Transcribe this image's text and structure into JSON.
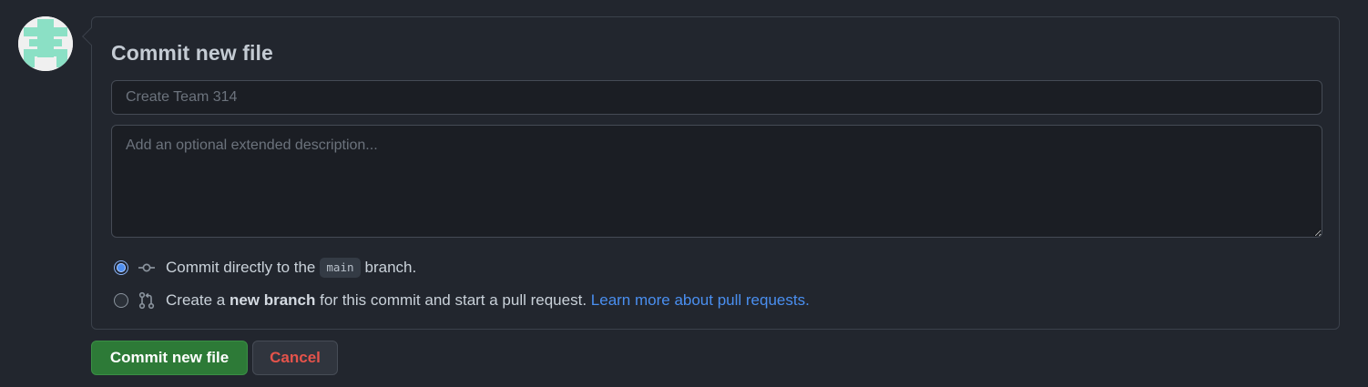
{
  "form": {
    "title": "Commit new file",
    "summary_placeholder": "Create Team 314",
    "summary_value": "",
    "description_placeholder": "Add an optional extended description...",
    "description_value": ""
  },
  "options": {
    "direct": {
      "selected": true,
      "prefix": "Commit directly to the",
      "branch": "main",
      "suffix": "branch."
    },
    "new_branch": {
      "selected": false,
      "prefix": "Create a",
      "bold": "new branch",
      "suffix": "for this commit and start a pull request.",
      "link": "Learn more about pull requests."
    }
  },
  "buttons": {
    "commit": "Commit new file",
    "cancel": "Cancel"
  },
  "icons": {
    "avatar": "identicon-avatar",
    "direct": "git-commit-icon",
    "new_branch": "git-pull-request-icon"
  },
  "colors": {
    "background": "#22262e",
    "primary_button": "#2d7a37",
    "danger_text": "#e5534b",
    "link": "#4a8ff0",
    "avatar_accent": "#8be0c5"
  }
}
